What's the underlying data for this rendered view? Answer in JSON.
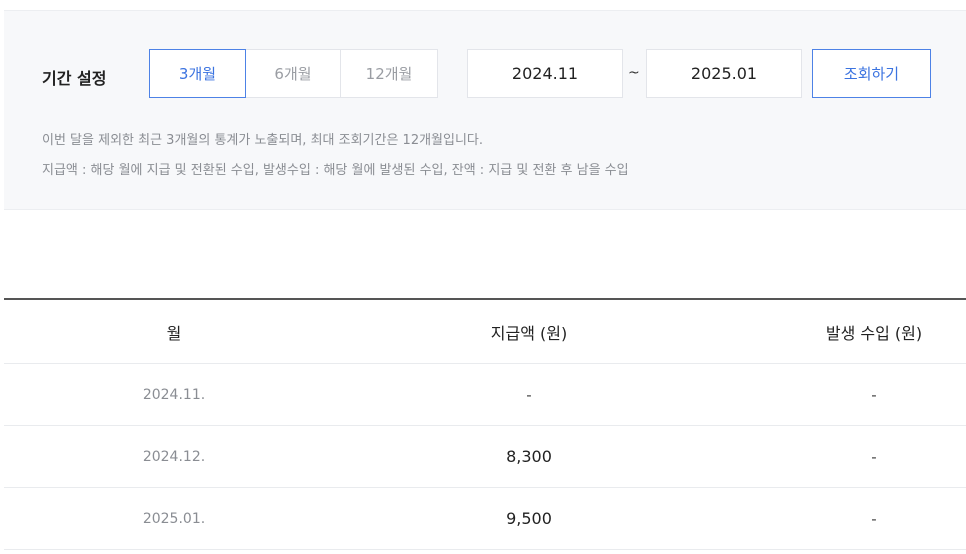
{
  "filter": {
    "period_label": "기간 설정",
    "segments": [
      {
        "label": "3개월",
        "active": true
      },
      {
        "label": "6개월",
        "active": false
      },
      {
        "label": "12개월",
        "active": false
      }
    ],
    "start_date": "2024.11",
    "separator": "~",
    "end_date": "2025.01",
    "search_label": "조회하기",
    "notes": [
      "이번 달을 제외한 최근 3개월의 통계가 노출되며, 최대 조회기간은 12개월입니다.",
      "지급액 : 해당 월에 지급 및 전환된 수입, 발생수입 : 해당 월에 발생된 수입, 잔액 : 지급 및 전환 후 남을 수입"
    ],
    "accent_color": "#3b73e0"
  },
  "table": {
    "headers": [
      "월",
      "지급액 (원)",
      "발생 수입 (원)"
    ],
    "rows": [
      {
        "month": "2024.11.",
        "paid": "-",
        "generated": "-"
      },
      {
        "month": "2024.12.",
        "paid": "8,300",
        "generated": "-"
      },
      {
        "month": "2025.01.",
        "paid": "9,500",
        "generated": "-"
      }
    ]
  }
}
